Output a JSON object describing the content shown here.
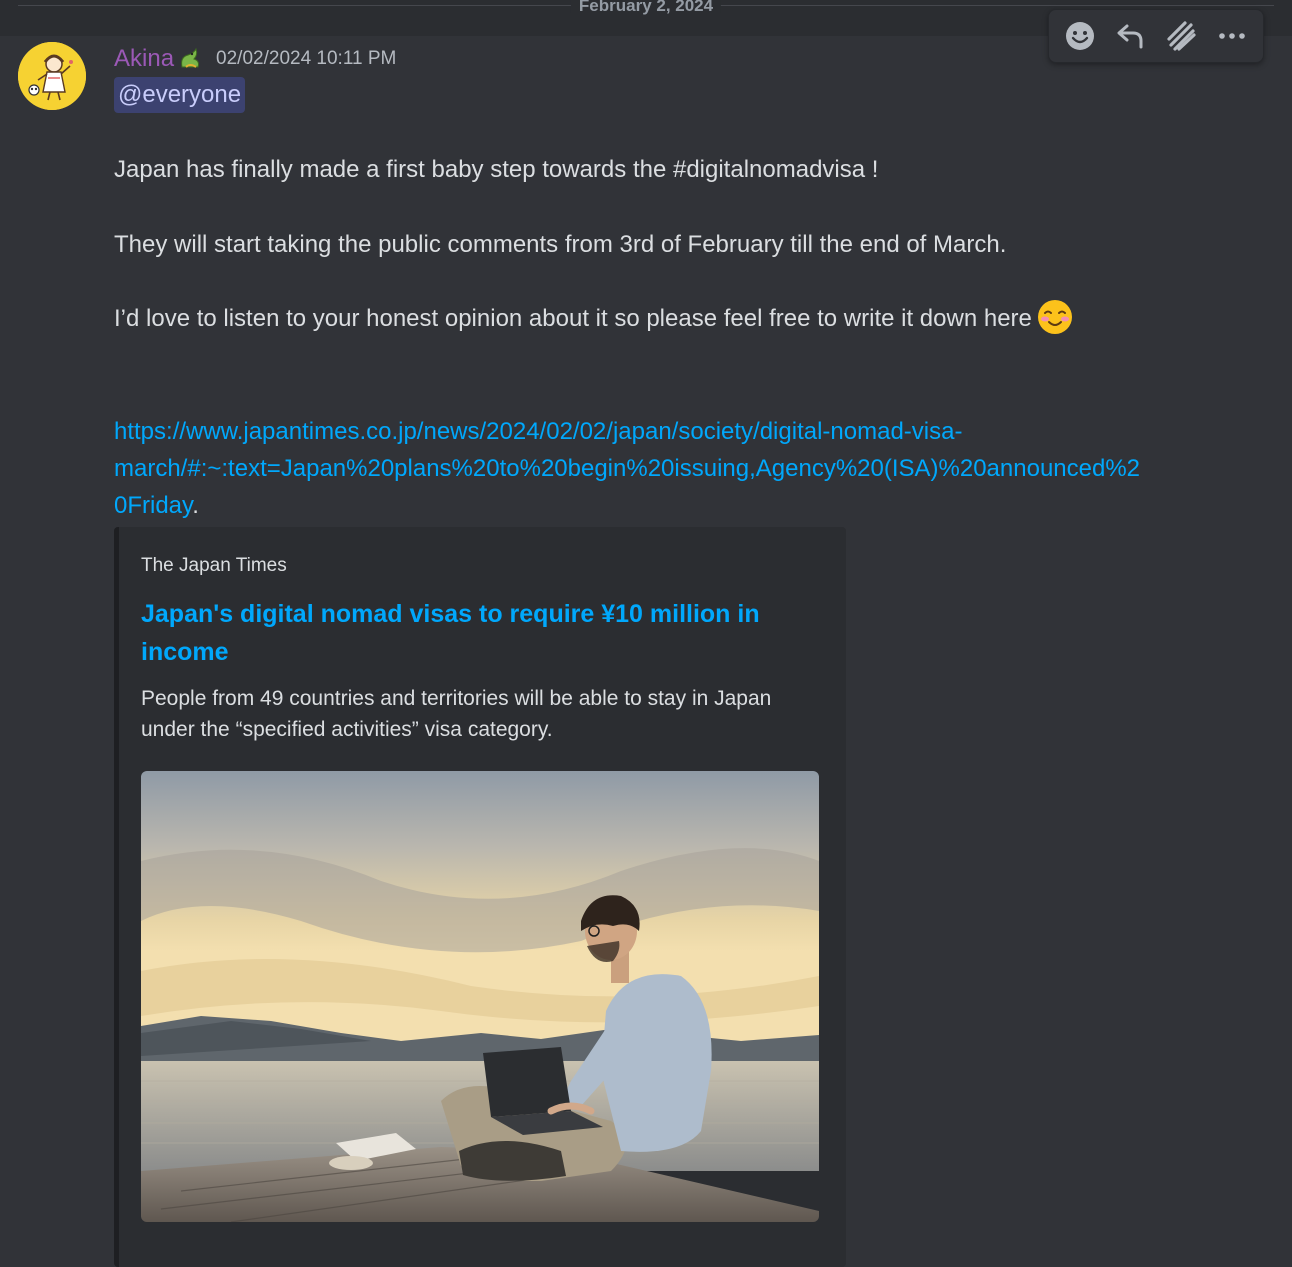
{
  "date_divider": "February 2, 2024",
  "toolbar": {
    "icons": [
      "add-reaction-icon",
      "reply-icon",
      "create-thread-icon",
      "more-options-icon"
    ]
  },
  "message": {
    "author": "Akina",
    "author_color": "#9b59b6",
    "timestamp": "02/02/2024 10:11 PM",
    "mention": "@everyone",
    "line1": "Japan has finally made a first baby step towards the #digitalnomadvisa !",
    "line2": "They will start taking the public comments from 3rd of February till the end of March.",
    "line3": "I’d love to listen to your honest opinion about it so please feel free to write it down here",
    "link_line1": "https://www.japantimes.co.jp/news/2024/02/02/japan/society/digital-nomad-visa-",
    "link_line2": "march/#:~:text=Japan%20plans%20to%20begin%20issuing,Agency%20(ISA)%20announced%2",
    "link_line3": "0Friday",
    "link_suffix": "."
  },
  "embed": {
    "provider": "The Japan Times",
    "title": "Japan's digital nomad visas to require ¥10 million in income",
    "description": "People from 49 countries and territories will be able to stay in Japan under the “specified activities” visa category."
  },
  "colors": {
    "background": "#313338",
    "link": "#00a8fc",
    "mention_bg": "#3c4270",
    "mention_text": "#c9cdfb",
    "embed_bg": "#2b2d31"
  }
}
